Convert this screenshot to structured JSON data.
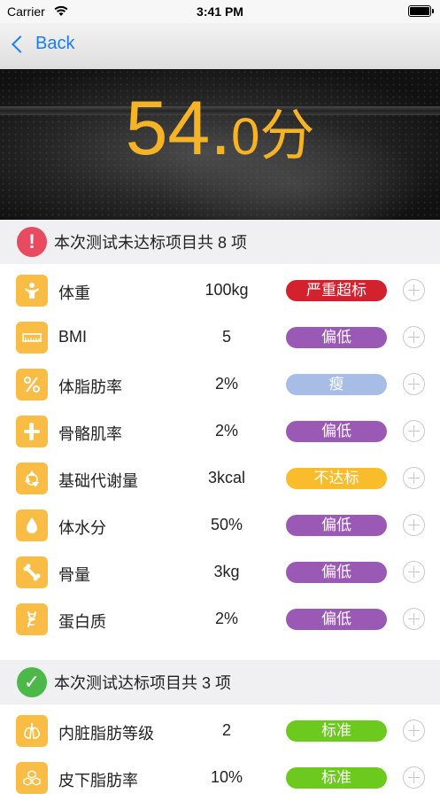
{
  "status_bar": {
    "carrier": "Carrier",
    "time": "3:41 PM"
  },
  "nav": {
    "back_label": "Back"
  },
  "hero": {
    "score_big": "54.",
    "score_small": "0",
    "score_unit": "分"
  },
  "fail_section": {
    "icon": "!",
    "title": "本次测试未达标项目共 8 项",
    "items": [
      {
        "icon": "body-icon",
        "name": "体重",
        "value": "100kg",
        "status": "严重超标",
        "status_color": "#d3212d"
      },
      {
        "icon": "ruler-icon",
        "name": "BMI",
        "value": "5",
        "status": "偏低",
        "status_color": "#9b59b6"
      },
      {
        "icon": "percent-icon",
        "name": "体脂肪率",
        "value": "2%",
        "status": "瘦",
        "status_color": "#a7bde6"
      },
      {
        "icon": "bone-joint-icon",
        "name": "骨骼肌率",
        "value": "2%",
        "status": "偏低",
        "status_color": "#9b59b6"
      },
      {
        "icon": "recycle-icon",
        "name": "基础代谢量",
        "value": "3kcal",
        "status": "不达标",
        "status_color": "#f9bd2c"
      },
      {
        "icon": "water-drop-icon",
        "name": "体水分",
        "value": "50%",
        "status": "偏低",
        "status_color": "#9b59b6"
      },
      {
        "icon": "bone-icon",
        "name": "骨量",
        "value": "3kg",
        "status": "偏低",
        "status_color": "#9b59b6"
      },
      {
        "icon": "dna-icon",
        "name": "蛋白质",
        "value": "2%",
        "status": "偏低",
        "status_color": "#9b59b6"
      }
    ]
  },
  "pass_section": {
    "icon": "✓",
    "title": "本次测试达标项目共 3 项",
    "items": [
      {
        "icon": "lungs-icon",
        "name": "内脏脂肪等级",
        "value": "2",
        "status": "标准",
        "status_color": "#6cc91e"
      },
      {
        "icon": "honeycomb-icon",
        "name": "皮下脂肪率",
        "value": "10%",
        "status": "标准",
        "status_color": "#6cc91e"
      }
    ]
  },
  "colors": {
    "accent": "#f5b325",
    "link": "#1a7cf5",
    "fail_badge": "#e84a5f",
    "pass_badge": "#4cb848",
    "icon_bg": "#f9bd45"
  }
}
